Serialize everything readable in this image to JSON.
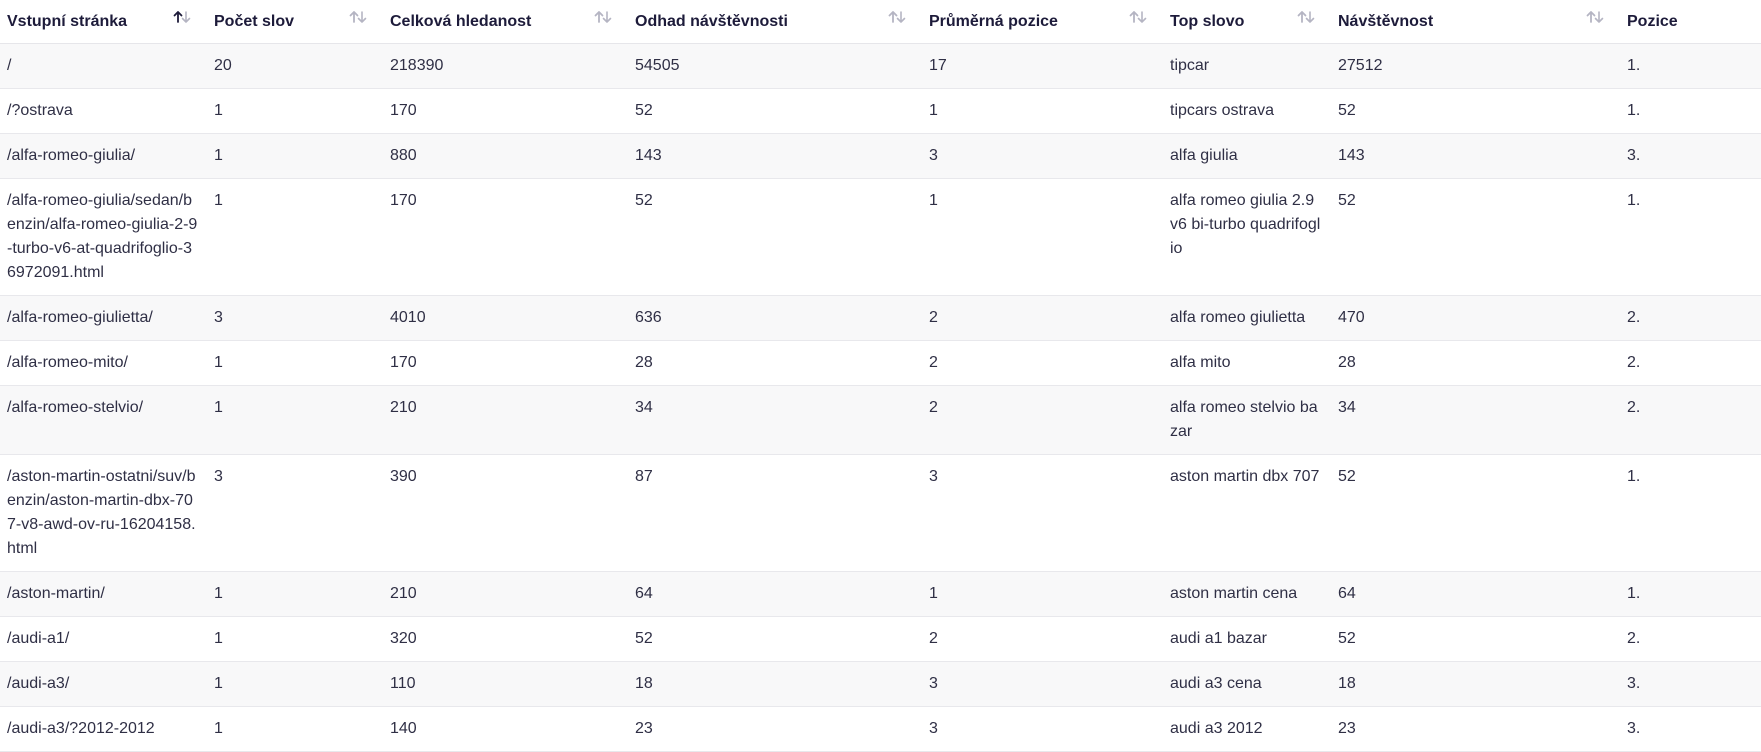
{
  "table": {
    "headers": [
      {
        "label": "Vstupní stránka",
        "sort": "asc"
      },
      {
        "label": "Počet slov",
        "sort": "none"
      },
      {
        "label": "Celková hledanost",
        "sort": "none"
      },
      {
        "label": "Odhad návštěvnosti",
        "sort": "none"
      },
      {
        "label": "Průměrná pozice",
        "sort": "none"
      },
      {
        "label": "Top slovo",
        "sort": "none"
      },
      {
        "label": "Návštěvnost",
        "sort": "none"
      },
      {
        "label": "Pozice",
        "sort": "none"
      }
    ],
    "rows": [
      [
        "/",
        "20",
        "218390",
        "54505",
        "17",
        "tipcar",
        "27512",
        "1."
      ],
      [
        "/?ostrava",
        "1",
        "170",
        "52",
        "1",
        "tipcars ostrava",
        "52",
        "1."
      ],
      [
        "/alfa-romeo-giulia/",
        "1",
        "880",
        "143",
        "3",
        "alfa giulia",
        "143",
        "3."
      ],
      [
        "/alfa-romeo-giulia/sedan/benzin/alfa-romeo-giulia-2-9-turbo-v6-at-quadrifoglio-36972091.html",
        "1",
        "170",
        "52",
        "1",
        "alfa romeo giulia 2.9 v6 bi-turbo quadrifoglio",
        "52",
        "1."
      ],
      [
        "/alfa-romeo-giulietta/",
        "3",
        "4010",
        "636",
        "2",
        "alfa romeo giulietta",
        "470",
        "2."
      ],
      [
        "/alfa-romeo-mito/",
        "1",
        "170",
        "28",
        "2",
        "alfa mito",
        "28",
        "2."
      ],
      [
        "/alfa-romeo-stelvio/",
        "1",
        "210",
        "34",
        "2",
        "alfa romeo stelvio bazar",
        "34",
        "2."
      ],
      [
        "/aston-martin-ostatni/suv/benzin/aston-martin-dbx-707-v8-awd-ov-ru-16204158.html",
        "3",
        "390",
        "87",
        "3",
        "aston martin dbx 707",
        "52",
        "1."
      ],
      [
        "/aston-martin/",
        "1",
        "210",
        "64",
        "1",
        "aston martin cena",
        "64",
        "1."
      ],
      [
        "/audi-a1/",
        "1",
        "320",
        "52",
        "2",
        "audi a1 bazar",
        "52",
        "2."
      ],
      [
        "/audi-a3/",
        "1",
        "110",
        "18",
        "3",
        "audi a3 cena",
        "18",
        "3."
      ],
      [
        "/audi-a3/?2012-2012",
        "1",
        "140",
        "23",
        "3",
        "audi a3 2012",
        "23",
        "3."
      ]
    ]
  },
  "icons": {
    "sort_active": "sort-asc-icon",
    "sort_inactive": "sort-icon"
  },
  "colors": {
    "header_text": "#1d1b3a",
    "body_text": "#2f2f45",
    "stripe": "#f8f8f9",
    "sort_icon_inactive": "#b5b5c3",
    "sort_icon_active": "#1d1b3a"
  }
}
